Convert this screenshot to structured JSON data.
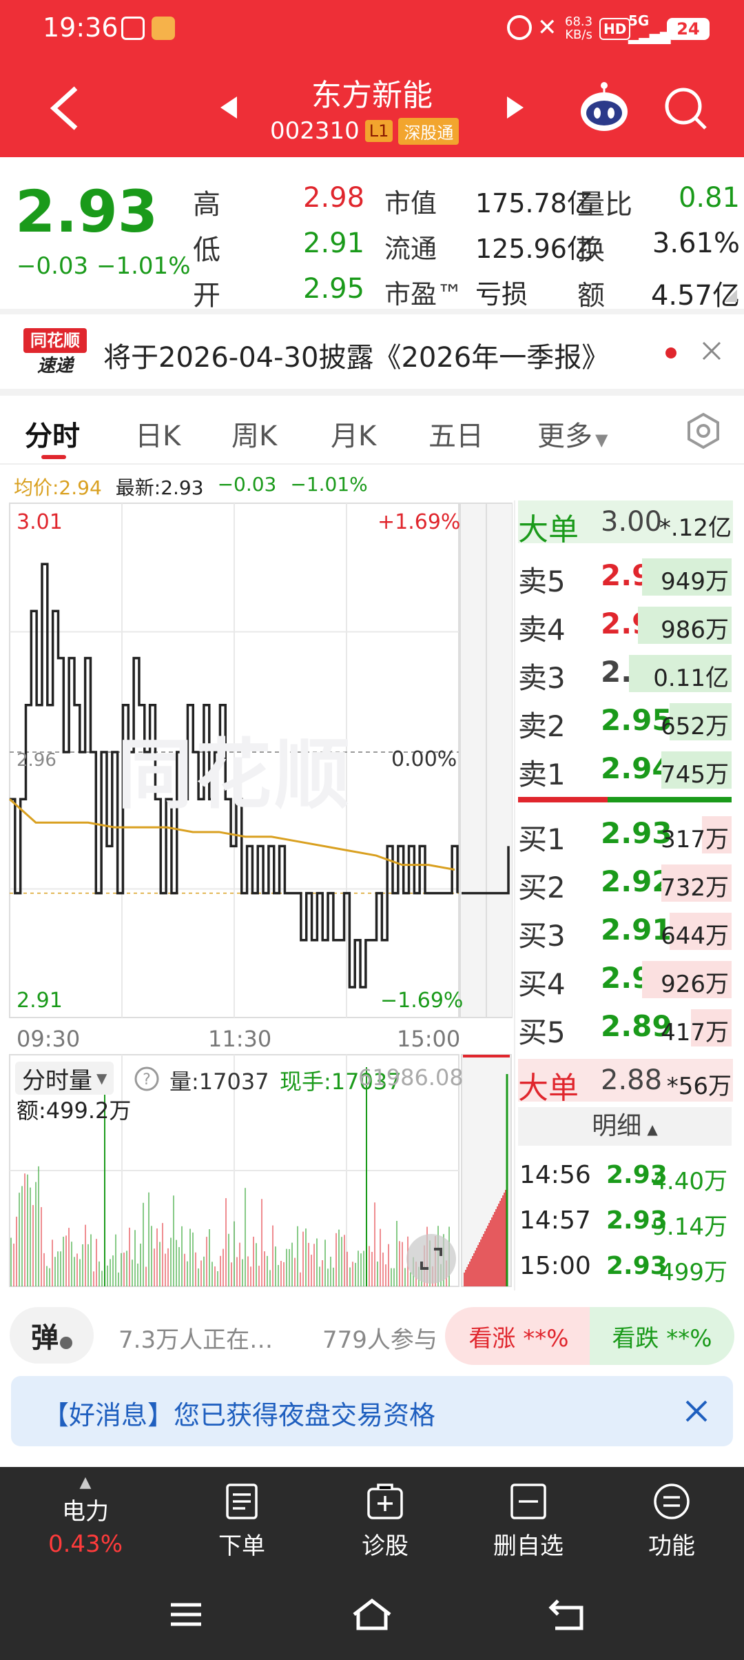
{
  "status": {
    "time": "19:36",
    "speed_top": "68.3",
    "speed_unit": "KB/s",
    "hd": "HD",
    "net": "5G",
    "battery": "24"
  },
  "header": {
    "title": "东方新能",
    "code": "002310",
    "level": "L1",
    "board": "深股通"
  },
  "quote": {
    "price": "2.93",
    "change": "−0.03",
    "change_pct": "−1.01%",
    "stats": [
      {
        "label": "高",
        "value": "2.98",
        "color": "#e0262d"
      },
      {
        "label": "低",
        "value": "2.91",
        "color": "#1a9a1a"
      },
      {
        "label": "开",
        "value": "2.95",
        "color": "#1a9a1a"
      }
    ],
    "mkt": [
      {
        "label": "市值",
        "value": "175.78亿"
      },
      {
        "label": "流通",
        "value": "125.96亿"
      },
      {
        "label": "市盈™",
        "value": "亏损"
      }
    ],
    "ratio": [
      {
        "label": "量比",
        "value": "0.81",
        "color": "#1a9a1a"
      },
      {
        "label": "换",
        "value": "3.61%",
        "color": "#222"
      },
      {
        "label": "额",
        "value": "4.57亿",
        "color": "#222"
      }
    ]
  },
  "notice": {
    "logo_top": "同花顺",
    "logo_bottom": "速递",
    "text": "将于2026-04-30披露《2026年一季报》"
  },
  "tabs": [
    "分时",
    "日K",
    "周K",
    "月K",
    "五日",
    "更多"
  ],
  "chart_info": {
    "avg_label": "均价:2.94",
    "latest_label": "最新:2.93",
    "chg": "−0.03",
    "chg_pct": "−1.01%"
  },
  "chart_data": {
    "type": "line",
    "title": "",
    "x_ticks": [
      "09:30",
      "11:30",
      "15:00"
    ],
    "y_left": {
      "max": "3.01",
      "mid": "2.96",
      "min": "2.91"
    },
    "y_right": {
      "max": "+1.69%",
      "mid": "0.00%",
      "min": "−1.69%"
    },
    "ylim": [
      2.91,
      3.01
    ],
    "watermark": "同花顺",
    "series": [
      {
        "color": "#222222",
        "values": [
          2.95,
          2.93,
          2.95,
          2.97,
          2.99,
          2.97,
          3.0,
          2.97,
          2.99,
          2.98,
          2.96,
          2.98,
          2.97,
          2.96,
          2.98,
          2.96,
          2.93,
          2.96,
          2.94,
          2.96,
          2.93,
          2.97,
          2.96,
          2.98,
          2.97,
          2.96,
          2.97,
          2.95,
          2.93,
          2.95,
          2.93,
          2.96,
          2.95,
          2.97,
          2.96,
          2.95,
          2.97,
          2.95,
          2.96,
          2.97,
          2.95,
          2.94,
          2.95,
          2.93,
          2.94,
          2.93,
          2.94,
          2.93,
          2.94,
          2.93,
          2.94,
          2.93,
          2.93,
          2.93,
          2.92,
          2.93,
          2.92,
          2.93,
          2.92,
          2.93,
          2.92,
          2.92,
          2.93,
          2.91,
          2.92,
          2.91,
          2.92,
          2.92,
          2.93,
          2.92,
          2.94,
          2.93,
          2.94,
          2.93,
          2.94,
          2.93,
          2.94,
          2.93,
          2.93,
          2.93,
          2.93,
          2.93,
          2.94,
          2.93
        ]
      },
      {
        "color": "#d9a020",
        "values": [
          2.95,
          2.945,
          2.945,
          2.945,
          2.944,
          2.944,
          2.944,
          2.943,
          2.943,
          2.942,
          2.942,
          2.941,
          2.94,
          2.939,
          2.938,
          2.936,
          2.936,
          2.935
        ]
      }
    ]
  },
  "volume": {
    "title": "分时量",
    "qty": "量:17037",
    "hand": "现手:17037",
    "amount": "额:499.2万",
    "scale": "61986.08"
  },
  "orderbook": {
    "big_top": {
      "label": "大单",
      "price": "3.00",
      "amount": "*.12亿"
    },
    "asks": [
      {
        "label": "卖5",
        "price": "2.98",
        "vol": "949万",
        "color": "#e0262d",
        "bar": 0.42
      },
      {
        "label": "卖4",
        "price": "2.97",
        "vol": "986万",
        "color": "#e0262d",
        "bar": 0.44
      },
      {
        "label": "卖3",
        "price": "2.96",
        "vol": "0.11亿",
        "color": "#444",
        "bar": 0.48
      },
      {
        "label": "卖2",
        "price": "2.95",
        "vol": "652万",
        "color": "#1a9a1a",
        "bar": 0.29
      },
      {
        "label": "卖1",
        "price": "2.94",
        "vol": "745万",
        "color": "#1a9a1a",
        "bar": 0.33
      }
    ],
    "bids": [
      {
        "label": "买1",
        "price": "2.93",
        "vol": "317万",
        "color": "#1a9a1a",
        "bar": 0.14
      },
      {
        "label": "买2",
        "price": "2.92",
        "vol": "732万",
        "color": "#1a9a1a",
        "bar": 0.33
      },
      {
        "label": "买3",
        "price": "2.91",
        "vol": "644万",
        "color": "#1a9a1a",
        "bar": 0.29
      },
      {
        "label": "买4",
        "price": "2.90",
        "vol": "926万",
        "color": "#1a9a1a",
        "bar": 0.42
      },
      {
        "label": "买5",
        "price": "2.89",
        "vol": "417万",
        "color": "#1a9a1a",
        "bar": 0.19
      }
    ],
    "big_bottom": {
      "label": "大单",
      "price": "2.88",
      "amount": "*56万"
    },
    "detail_label": "明细",
    "trades": [
      {
        "time": "14:56",
        "price": "2.93",
        "vol": "4.40万"
      },
      {
        "time": "14:57",
        "price": "2.93",
        "vol": "9.14万"
      },
      {
        "time": "15:00",
        "price": "2.93",
        "vol": "499万"
      }
    ]
  },
  "bullet": {
    "icon_label": "弹",
    "watchers": "7.3万人正在…",
    "participants": "779人参与",
    "up": "看涨 **%",
    "down": "看跌 **%"
  },
  "banner": {
    "text": "【好消息】您已获得夜盘交易资格"
  },
  "bottom_nav": {
    "power_label": "电力",
    "power_pct": "0.43%",
    "items": [
      "下单",
      "诊股",
      "删自选",
      "功能"
    ]
  }
}
